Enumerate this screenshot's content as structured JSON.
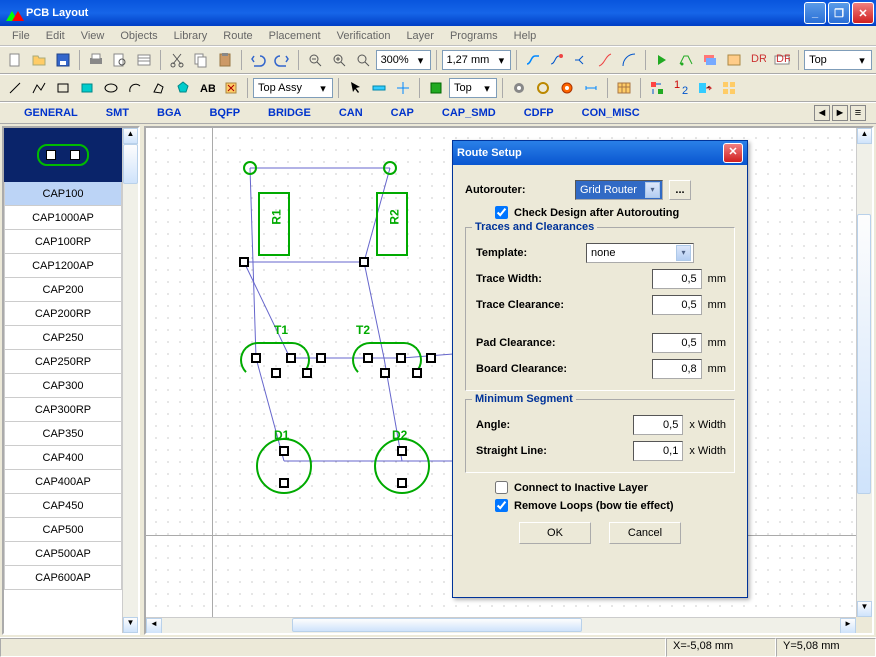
{
  "window": {
    "title": "PCB Layout"
  },
  "menu": [
    "File",
    "Edit",
    "View",
    "Objects",
    "Library",
    "Route",
    "Placement",
    "Verification",
    "Layer",
    "Programs",
    "Help"
  ],
  "toolbar1": {
    "zoom_value": "300%",
    "grid_value": "1,27 mm",
    "layer_combo": "Top"
  },
  "toolbar2": {
    "assy_combo": "Top Assy",
    "layer_combo2": "Top"
  },
  "category_tabs": [
    "GENERAL",
    "SMT",
    "BGA",
    "BQFP",
    "BRIDGE",
    "CAN",
    "CAP",
    "CAP_SMD",
    "CDFP",
    "CON_MISC"
  ],
  "parts": {
    "selected": "CAP100",
    "items": [
      "CAP100",
      "CAP1000AP",
      "CAP100RP",
      "CAP1200AP",
      "CAP200",
      "CAP200RP",
      "CAP250",
      "CAP250RP",
      "CAP300",
      "CAP300RP",
      "CAP350",
      "CAP400",
      "CAP400AP",
      "CAP450",
      "CAP500",
      "CAP500AP",
      "CAP600AP"
    ]
  },
  "canvas": {
    "labels": {
      "R1": "R1",
      "R2": "R2",
      "T1": "T1",
      "T2": "T2",
      "D1": "D1",
      "D2": "D2"
    }
  },
  "dialog": {
    "title": "Route Setup",
    "autorouter_label": "Autorouter:",
    "autorouter_value": "Grid Router",
    "check_design": "Check Design after Autorouting",
    "group_traces": "Traces and Clearances",
    "template_label": "Template:",
    "template_value": "none",
    "trace_width_label": "Trace Width:",
    "trace_width_value": "0,5",
    "trace_clearance_label": "Trace Clearance:",
    "trace_clearance_value": "0,5",
    "pad_clearance_label": "Pad Clearance:",
    "pad_clearance_value": "0,5",
    "board_clearance_label": "Board Clearance:",
    "board_clearance_value": "0,8",
    "mm": "mm",
    "group_min": "Minimum Segment",
    "angle_label": "Angle:",
    "angle_value": "0,5",
    "straight_label": "Straight Line:",
    "straight_value": "0,1",
    "xwidth": "x Width",
    "connect_inactive": "Connect to Inactive Layer",
    "remove_loops": "Remove Loops (bow tie effect)",
    "ok": "OK",
    "cancel": "Cancel",
    "ellipsis": "..."
  },
  "status": {
    "x": "X=-5,08 mm",
    "y": "Y=5,08 mm"
  }
}
